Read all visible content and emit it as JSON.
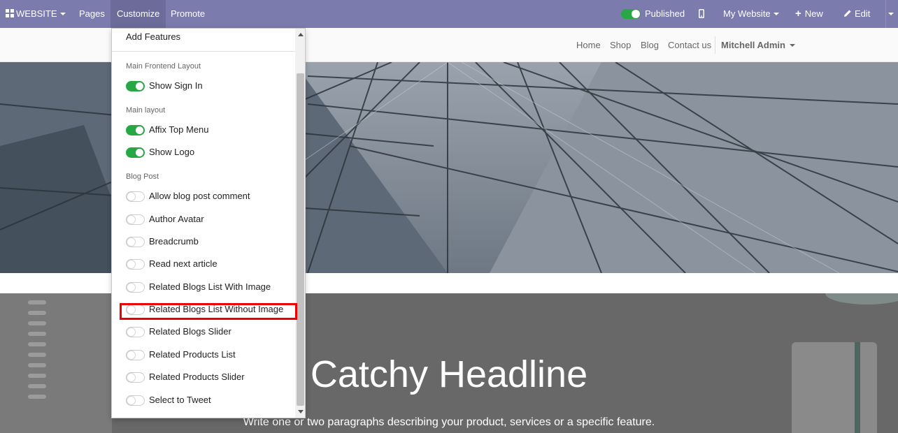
{
  "topbar": {
    "apps_label": "WEBSITE",
    "menu": [
      "Pages",
      "Customize",
      "Promote"
    ],
    "published_label": "Published",
    "site_selector": "My Website",
    "new_label": "New",
    "edit_label": "Edit",
    "colors": {
      "bar": "#7c7bad",
      "active": "#6c6b9a"
    }
  },
  "site_nav": {
    "links": [
      "Home",
      "Shop",
      "Blog",
      "Contact us"
    ],
    "user": "Mitchell Admin"
  },
  "panel": {
    "title": "Add Features",
    "sections": [
      {
        "title": "Main Frontend Layout",
        "items": [
          {
            "label": "Show Sign In",
            "on": true
          }
        ]
      },
      {
        "title": "Main layout",
        "items": [
          {
            "label": "Affix Top Menu",
            "on": true
          },
          {
            "label": "Show Logo",
            "on": true
          }
        ]
      },
      {
        "title": "Blog Post",
        "items": [
          {
            "label": "Allow blog post comment",
            "on": false
          },
          {
            "label": "Author Avatar",
            "on": false
          },
          {
            "label": "Breadcrumb",
            "on": false
          },
          {
            "label": "Read next article",
            "on": false
          },
          {
            "label": "Related Blogs List With Image",
            "on": false
          },
          {
            "label": "Related Blogs List Without Image",
            "on": false
          },
          {
            "label": "Related Blogs Slider",
            "on": false
          },
          {
            "label": "Related Products List",
            "on": false
          },
          {
            "label": "Related Products Slider",
            "on": false
          },
          {
            "label": "Select to Tweet",
            "on": false
          }
        ]
      }
    ]
  },
  "content": {
    "headline": "Catchy Headline",
    "subline": "Write one or two paragraphs describing your product, services or a specific feature."
  }
}
